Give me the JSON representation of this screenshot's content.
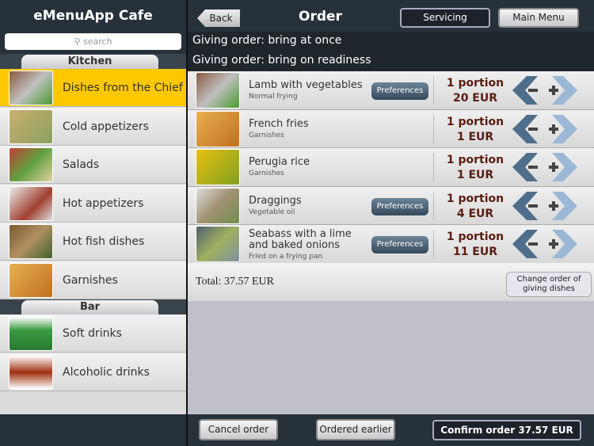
{
  "sidebar": {
    "title": "eMenuApp Cafe",
    "search_placeholder": "search",
    "sections": [
      {
        "label": "Kitchen",
        "items": [
          {
            "label": "Dishes from the Chief",
            "selected": true
          },
          {
            "label": "Cold appetizers"
          },
          {
            "label": "Salads"
          },
          {
            "label": "Hot appetizers"
          },
          {
            "label": "Hot fish dishes"
          },
          {
            "label": "Garnishes"
          }
        ]
      },
      {
        "label": "Bar",
        "items": [
          {
            "label": "Soft drinks"
          },
          {
            "label": "Alcoholic drinks"
          }
        ]
      }
    ]
  },
  "header": {
    "back": "Back",
    "title": "Order",
    "servicing": "Servicing",
    "main_menu": "Main Menu"
  },
  "giving": [
    "Giving order: bring at once",
    "Giving order: bring on readiness"
  ],
  "order": [
    {
      "name": "Lamb with vegetables",
      "sub": "Normal frying",
      "pref": "Preferences",
      "qty": "1 portion",
      "price": "20 EUR"
    },
    {
      "name": "French fries",
      "sub": "Garnishes",
      "qty": "1 portion",
      "price": "1 EUR"
    },
    {
      "name": "Perugia rice",
      "sub": "Garnishes",
      "qty": "1 portion",
      "price": "1 EUR"
    },
    {
      "name": "Draggings",
      "sub": "Vegetable oil",
      "pref": "Preferences",
      "qty": "1 portion",
      "price": "4 EUR"
    },
    {
      "name": "Seabass with a lime and baked onions",
      "sub": "Fried on a frying pan",
      "pref": "Preferences",
      "qty": "1 portion",
      "price": "11 EUR"
    }
  ],
  "total": "Total: 37.57 EUR",
  "change_order": "Change order of giving dishes",
  "footer": {
    "cancel": "Cancel order",
    "earlier": "Ordered earlier",
    "confirm": "Confirm order 37.57 EUR"
  },
  "colors": {
    "selected": "#fdc800",
    "price": "#5a1c10"
  }
}
